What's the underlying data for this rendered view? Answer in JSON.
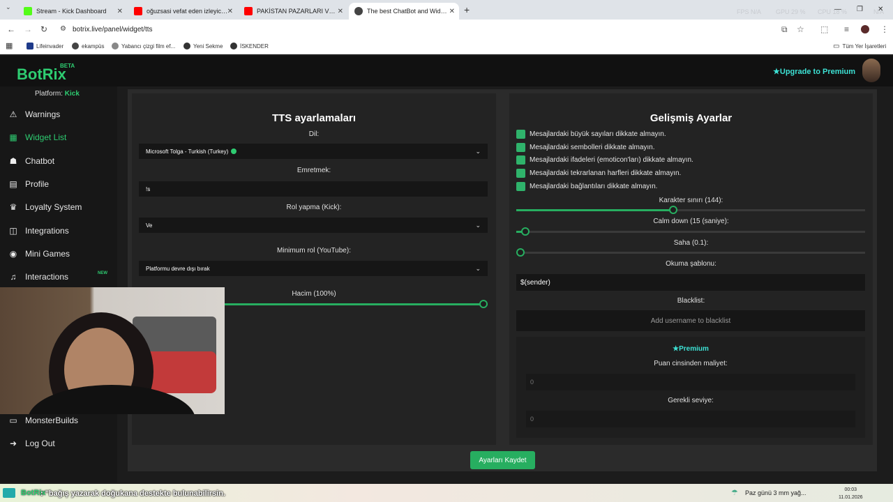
{
  "browser": {
    "tabs": [
      {
        "title": "Stream - Kick Dashboard",
        "color": "#53fc18"
      },
      {
        "title": "oğuzsasi vefat eden izleyicisi hakkında",
        "color": "#ff0000"
      },
      {
        "title": "PAKİSTAN PAZARLARI VE SOKAKLARI",
        "color": "#ff0000"
      },
      {
        "title": "The best ChatBot and Widgets",
        "color": "#444444"
      }
    ],
    "hud": {
      "fps": "FPS N/A",
      "gpu": "GPU 29 %",
      "cpu": "CPU 18 %",
      "ram": "N/A"
    },
    "url": "botrix.live/panel/widget/tts",
    "bookmarks": [
      "Lifeinvader",
      "ekampüs",
      "Yabancı çizgi film ef...",
      "Yeni Sekme",
      "İSKENDER"
    ],
    "all_bookmarks": "Tüm Yer İşaretleri"
  },
  "app": {
    "logo": "BotRix",
    "beta": "BETA",
    "upgrade": "Upgrade to Premium",
    "platform_label": "Platform:",
    "platform_value": "Kick",
    "sidebar": [
      {
        "label": "Warnings",
        "icon": "⚠"
      },
      {
        "label": "Widget List",
        "icon": "▦"
      },
      {
        "label": "Chatbot",
        "icon": "☗"
      },
      {
        "label": "Profile",
        "icon": "▤"
      },
      {
        "label": "Loyalty System",
        "icon": "♛"
      },
      {
        "label": "Integrations",
        "icon": "◫"
      },
      {
        "label": "Mini Games",
        "icon": "◉"
      },
      {
        "label": "Interactions",
        "icon": "♫"
      }
    ],
    "new_badge": "NEW",
    "sidebar_bottom": [
      {
        "label": "MonsterBuilds",
        "icon": "▭"
      },
      {
        "label": "Log Out",
        "icon": "➜"
      }
    ]
  },
  "tts": {
    "title": "TTS ayarlamaları",
    "dil_label": "Dil:",
    "dil_value": "Microsoft Tolga - Turkish (Turkey)",
    "emretmek_label": "Emretmek:",
    "emretmek_value": "!s",
    "rol_kick_label": "Rol yapma (Kick):",
    "rol_kick_value": "Ve",
    "min_rol_label": "Minimum rol (YouTube):",
    "min_rol_value": "Platformu devre dışı bırak",
    "hacim_label": "Hacim (100%)",
    "hacim_value": 1.0
  },
  "advanced": {
    "title": "Gelişmiş Ayarlar",
    "checks": [
      "Mesajlardaki büyük sayıları dikkate almayın.",
      "Mesajlardaki sembolleri dikkate almayın.",
      "Mesajlardaki ifadeleri (emoticon'ları) dikkate almayın.",
      "Mesajlardaki tekrarlanan harfleri dikkate almayın.",
      "Mesajlardaki bağlantıları dikkate almayın."
    ],
    "karakter_label": "Karakter sınırı (144):",
    "karakter_value": 0.45,
    "calm_label": "Calm down (15 (saniye):",
    "calm_value": 0.025,
    "saha_label": "Saha (0.1):",
    "saha_value": 0.0,
    "okuma_label": "Okuma şablonu:",
    "okuma_value": "$(sender)",
    "blacklist_label": "Blacklist:",
    "blacklist_placeholder": "Add username to blacklist",
    "premium_title": "Premium",
    "puan_label": "Puan cinsinden maliyet:",
    "puan_value": "0",
    "seviye_label": "Gerekli seviye:",
    "seviye_value": "0"
  },
  "save_label": "Ayarları Kaydet",
  "taskbar": {
    "brand": "BotRix",
    "ticker": ": \"bağış yazarak doğukana destekte bulunabilirsin.",
    "weather": "Paz günü 3 mm yağ...",
    "time": "00:03",
    "date": "11.01.2026"
  }
}
